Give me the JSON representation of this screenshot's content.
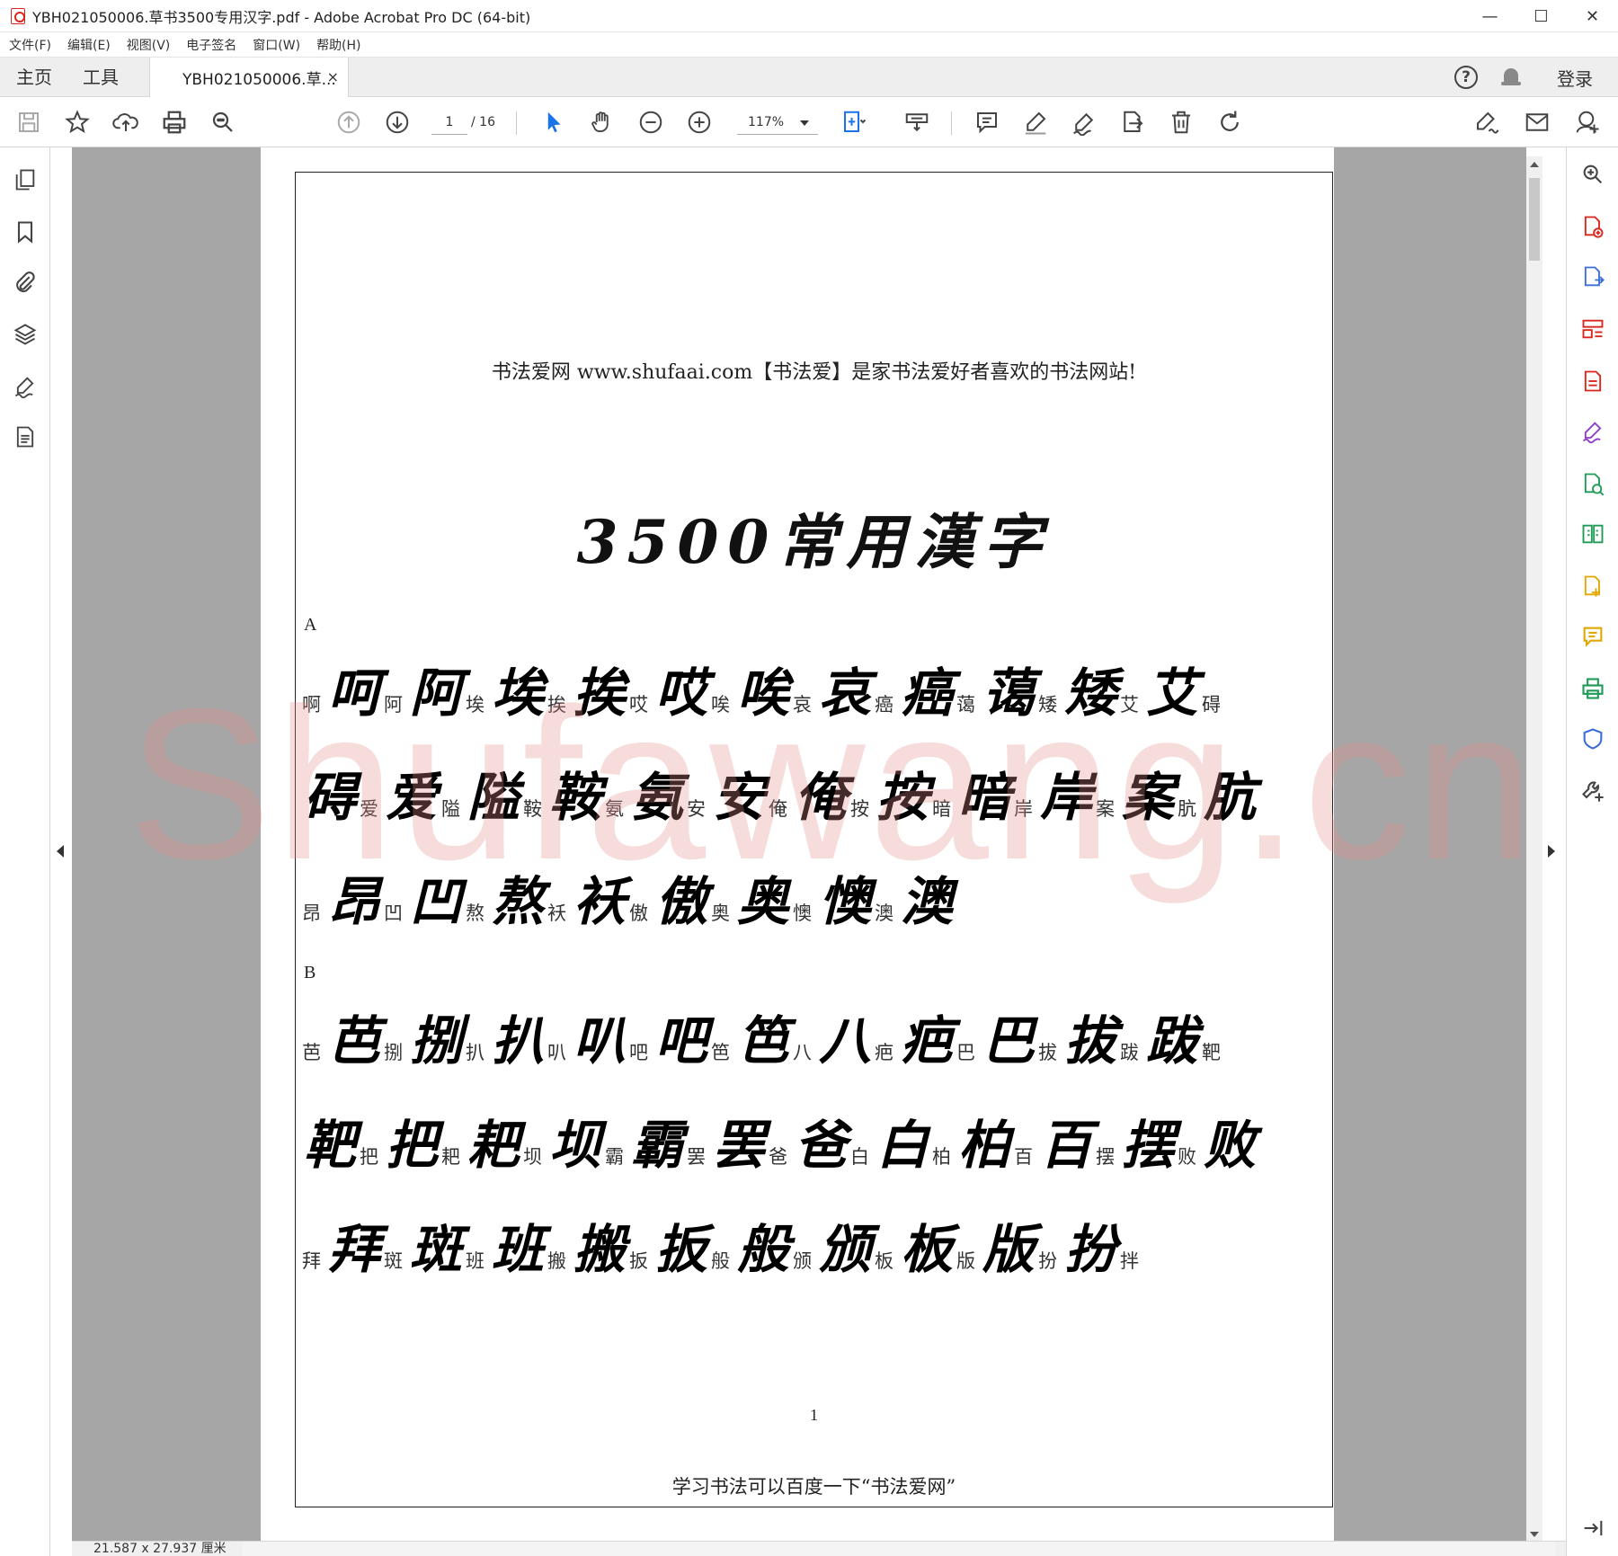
{
  "window": {
    "title": "YBH021050006.草书3500专用汉字.pdf - Adobe Acrobat Pro DC (64-bit)",
    "minimize": "—",
    "maximize": "☐",
    "close": "✕"
  },
  "menu": [
    "文件(F)",
    "编辑(E)",
    "视图(V)",
    "电子签名",
    "窗口(W)",
    "帮助(H)"
  ],
  "tabs": {
    "home": "主页",
    "tools": "工具",
    "document": "YBH021050006.草...",
    "close": "×",
    "help": "?",
    "login": "登录"
  },
  "toolbar": {
    "page_current": "1",
    "page_total": "/ 16",
    "zoom": "117%"
  },
  "document": {
    "header": "书法爱网 www.shufaai.com【书法爱】是家书法爱好者喜欢的书法网站!",
    "title": "3500常用漢字",
    "sections": [
      {
        "letter": "A",
        "rows": [
          [
            [
              "啊",
              "呵"
            ],
            [
              "阿",
              "阿"
            ],
            [
              "埃",
              "埃"
            ],
            [
              "挨",
              "挨"
            ],
            [
              "哎",
              "哎"
            ],
            [
              "唉",
              "唉"
            ],
            [
              "哀",
              "哀"
            ],
            [
              "癌",
              "癌"
            ],
            [
              "蔼",
              "蔼"
            ],
            [
              "矮",
              "矮"
            ],
            [
              "艾",
              "艾"
            ],
            [
              "碍",
              ""
            ]
          ],
          [
            [
              "",
              "碍"
            ],
            [
              "爱",
              "爱"
            ],
            [
              "隘",
              "隘"
            ],
            [
              "鞍",
              "鞍"
            ],
            [
              "氨",
              "氨"
            ],
            [
              "安",
              "安"
            ],
            [
              "俺",
              "俺"
            ],
            [
              "按",
              "按"
            ],
            [
              "暗",
              "暗"
            ],
            [
              "岸",
              "岸"
            ],
            [
              "案",
              "案"
            ],
            [
              "肮",
              "肮"
            ]
          ],
          [
            [
              "昂",
              "昂"
            ],
            [
              "凹",
              "凹"
            ],
            [
              "熬",
              "熬"
            ],
            [
              "袄",
              "袄"
            ],
            [
              "傲",
              "傲"
            ],
            [
              "奥",
              "奥"
            ],
            [
              "懊",
              "懊"
            ],
            [
              "澳",
              "澳"
            ]
          ]
        ]
      },
      {
        "letter": "B",
        "rows": [
          [
            [
              "芭",
              "芭"
            ],
            [
              "捌",
              "捌"
            ],
            [
              "扒",
              "扒"
            ],
            [
              "叭",
              "叭"
            ],
            [
              "吧",
              "吧"
            ],
            [
              "笆",
              "笆"
            ],
            [
              "八",
              "八"
            ],
            [
              "疤",
              "疤"
            ],
            [
              "巴",
              "巴"
            ],
            [
              "拔",
              "拔"
            ],
            [
              "跋",
              "跋"
            ],
            [
              "靶",
              ""
            ]
          ],
          [
            [
              "",
              "靶"
            ],
            [
              "把",
              "把"
            ],
            [
              "耙",
              "耙"
            ],
            [
              "坝",
              "坝"
            ],
            [
              "霸",
              "霸"
            ],
            [
              "罢",
              "罢"
            ],
            [
              "爸",
              "爸"
            ],
            [
              "白",
              "白"
            ],
            [
              "柏",
              "柏"
            ],
            [
              "百",
              "百"
            ],
            [
              "摆",
              "摆"
            ],
            [
              "败",
              "败"
            ]
          ],
          [
            [
              "拜",
              "拜"
            ],
            [
              "斑",
              "斑"
            ],
            [
              "班",
              "班"
            ],
            [
              "搬",
              "搬"
            ],
            [
              "扳",
              "扳"
            ],
            [
              "般",
              "般"
            ],
            [
              "颁",
              "颁"
            ],
            [
              "板",
              "板"
            ],
            [
              "版",
              "版"
            ],
            [
              "扮",
              "扮"
            ],
            [
              "拌",
              ""
            ]
          ]
        ]
      }
    ],
    "page_number": "1",
    "footer": "学习书法可以百度一下“书法爱网”",
    "watermark": "Shufawang.cn"
  },
  "status": {
    "page_size": "21.587 x 27.937 厘米"
  }
}
